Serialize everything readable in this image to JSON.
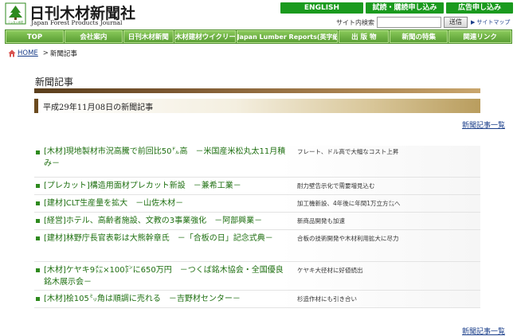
{
  "header": {
    "logo_main": "日刊木材新聞社",
    "logo_sub": "Japan Forest Products Journal",
    "logo_mark_text": "ニッカン木材",
    "top_links": [
      {
        "id": "english",
        "label": "ENGLISH"
      },
      {
        "id": "trial",
        "label": "試読・購読申し込み"
      },
      {
        "id": "ad",
        "label": "広告申し込み"
      }
    ],
    "search_label": "サイト内検索",
    "search_value": "",
    "search_button": "送信",
    "sitemap_label": "サイトマップ"
  },
  "nav": [
    {
      "id": "top",
      "label": "TOP"
    },
    {
      "id": "company",
      "label": "会社案内"
    },
    {
      "id": "news",
      "label": "日刊木材新聞"
    },
    {
      "id": "weekly",
      "label": "木材建材ウイクリー"
    },
    {
      "id": "jlr",
      "label": "Japan Lumber Reports(英字紙)"
    },
    {
      "id": "pub",
      "label": "出 版 物"
    },
    {
      "id": "feature",
      "label": "新聞の特集"
    },
    {
      "id": "links",
      "label": "関連リンク"
    }
  ],
  "breadcrumb": {
    "home": "HOME",
    "separator": ">",
    "current": "新聞記事"
  },
  "main": {
    "title": "新聞記事",
    "date_heading": "平成29年11月08日の新聞記事",
    "list_link": "新聞記事一覧",
    "articles": [
      {
        "headline": "[木材]現地製材市況高騰で前回比50㌦高　－米国産米松丸太11月積み－",
        "summary": "フレート、ドル高で大幅なコスト上昇"
      },
      {
        "headline": "[プレカット]構造用面材プレカット新設　－兼希工業－",
        "summary": "耐力壁告示化で需要増見込む"
      },
      {
        "headline": "[建材]CLT生産量を拡大　－山佐木材－",
        "summary": "加工機新設、4年後に年間1万立方㍍へ"
      },
      {
        "headline": "[経営]ホテル、高齢者施設、文教の3事業強化　－阿部興業－",
        "summary": "新商品開発も加速"
      },
      {
        "headline": "[建材]林野庁長官表彰は大熊幹章氏　－「合板の日」記念式典－",
        "summary": "合板の技術開発や木材利用拡大に尽力"
      },
      {
        "headline": "[木材]ケヤキ9㍍×100㌢に650万円　－つくば銘木協会・全国優良銘木展示会－",
        "summary": "ケヤキ大径材に好値続出"
      },
      {
        "headline": "[木材]桧105㍉角は順調に売れる　－吉野材センター－",
        "summary": "杉造作材にも引き合い"
      }
    ]
  },
  "colors": {
    "brand_green": "#1a9a1e",
    "nav_green": "#5a9e34",
    "headline_green": "#1e6f10",
    "link_blue": "#1a3e8a",
    "rule_brown": "#6b4a1e"
  }
}
